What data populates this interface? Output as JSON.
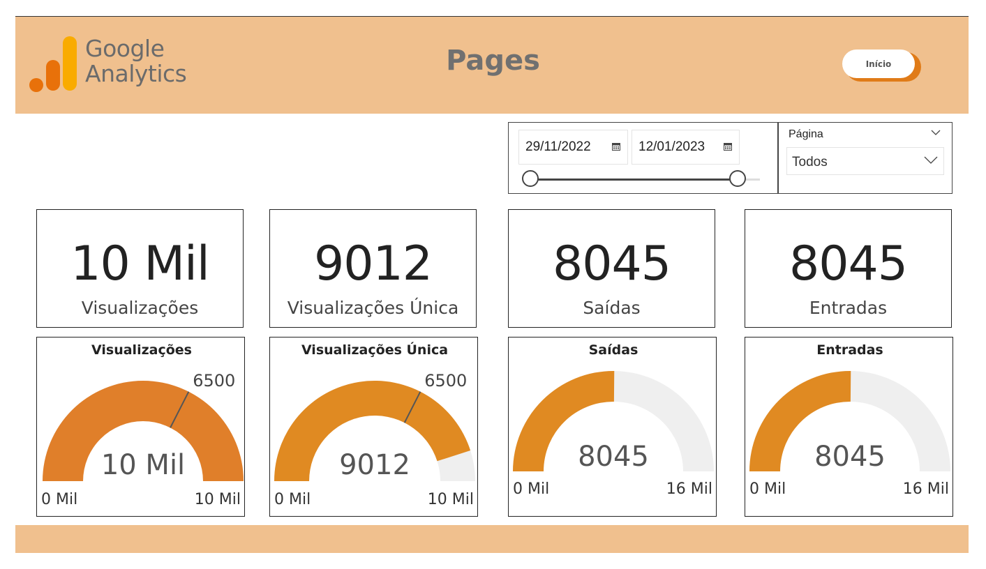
{
  "header": {
    "logo_line1": "Google",
    "logo_line2": "Analytics",
    "title": "Pages",
    "home_button": "Início",
    "colors": {
      "header_bg": "#f0c08e",
      "accent": "#e07b18"
    }
  },
  "filters": {
    "date_start": "29/11/2022",
    "date_end": "12/01/2023",
    "page_label": "Página",
    "page_value": "Todos"
  },
  "cards": [
    {
      "value": "10 Mil",
      "label": "Visualizações"
    },
    {
      "value": "9012",
      "label": "Visualizações Única"
    },
    {
      "value": "8045",
      "label": "Saídas"
    },
    {
      "value": "8045",
      "label": "Entradas"
    }
  ],
  "chart_data": [
    {
      "type": "gauge",
      "title": "Visualizações",
      "value": 10000,
      "value_label": "10 Mil",
      "min": 0,
      "max": 10000,
      "min_label": "0 Mil",
      "max_label": "10 Mil",
      "target": 6500,
      "target_label": "6500",
      "fill_color": "#e07f2a",
      "track_color": "#efefef"
    },
    {
      "type": "gauge",
      "title": "Visualizações Única",
      "value": 9012,
      "value_label": "9012",
      "min": 0,
      "max": 10000,
      "min_label": "0 Mil",
      "max_label": "10 Mil",
      "target": 6500,
      "target_label": "6500",
      "fill_color": "#e08a22",
      "track_color": "#efefef"
    },
    {
      "type": "gauge",
      "title": "Saídas",
      "value": 8045,
      "value_label": "8045",
      "min": 0,
      "max": 16000,
      "min_label": "0 Mil",
      "max_label": "16 Mil",
      "fill_color": "#e08a22",
      "track_color": "#efefef"
    },
    {
      "type": "gauge",
      "title": "Entradas",
      "value": 8045,
      "value_label": "8045",
      "min": 0,
      "max": 16000,
      "min_label": "0 Mil",
      "max_label": "16 Mil",
      "fill_color": "#e08a22",
      "track_color": "#efefef"
    }
  ]
}
